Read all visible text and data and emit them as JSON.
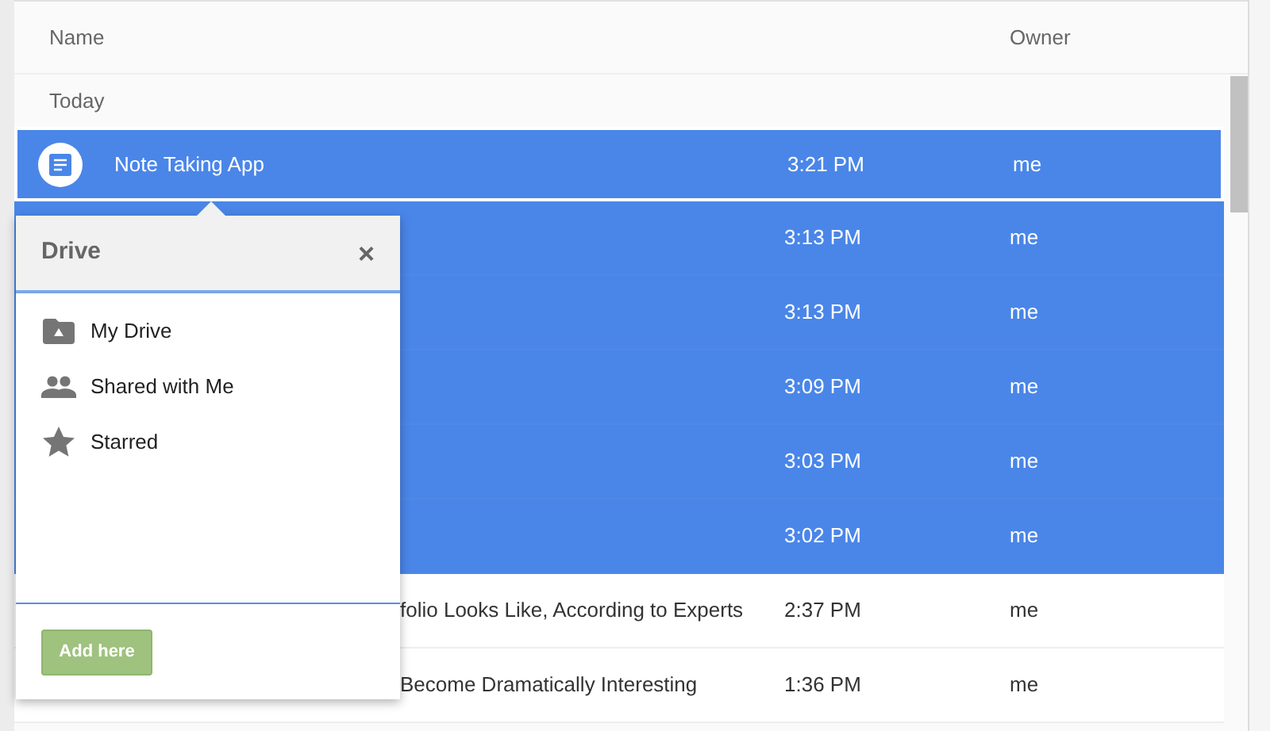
{
  "table": {
    "columns": [
      {
        "label": "Name"
      },
      {
        "label": "Owner"
      }
    ],
    "group": "Today",
    "rows": [
      {
        "name": "Note Taking App",
        "time": "3:21 PM",
        "owner": "me",
        "selected": true,
        "focused": true
      },
      {
        "time": "3:13 PM",
        "owner": "me",
        "selected": true,
        "focused": false
      },
      {
        "time": "3:13 PM",
        "owner": "me",
        "selected": true,
        "focused": false
      },
      {
        "time": "3:09 PM",
        "owner": "me",
        "selected": true,
        "focused": false
      },
      {
        "time": "3:03 PM",
        "owner": "me",
        "selected": true,
        "focused": false
      },
      {
        "time": "3:02 PM",
        "owner": "me",
        "selected": true,
        "focused": false
      },
      {
        "name": "folio Looks Like, According to Experts",
        "name_clipped": true,
        "time": "2:37 PM",
        "owner": "me",
        "selected": false,
        "focused": false
      },
      {
        "name": "Become Dramatically Interesting",
        "name_clipped": true,
        "time": "1:36 PM",
        "owner": "me",
        "selected": false,
        "focused": false
      }
    ]
  },
  "popup": {
    "title": "Drive",
    "close": "×",
    "items": [
      {
        "label": "My Drive"
      },
      {
        "label": "Shared with Me"
      },
      {
        "label": "Starred"
      }
    ],
    "button": "Add here"
  }
}
